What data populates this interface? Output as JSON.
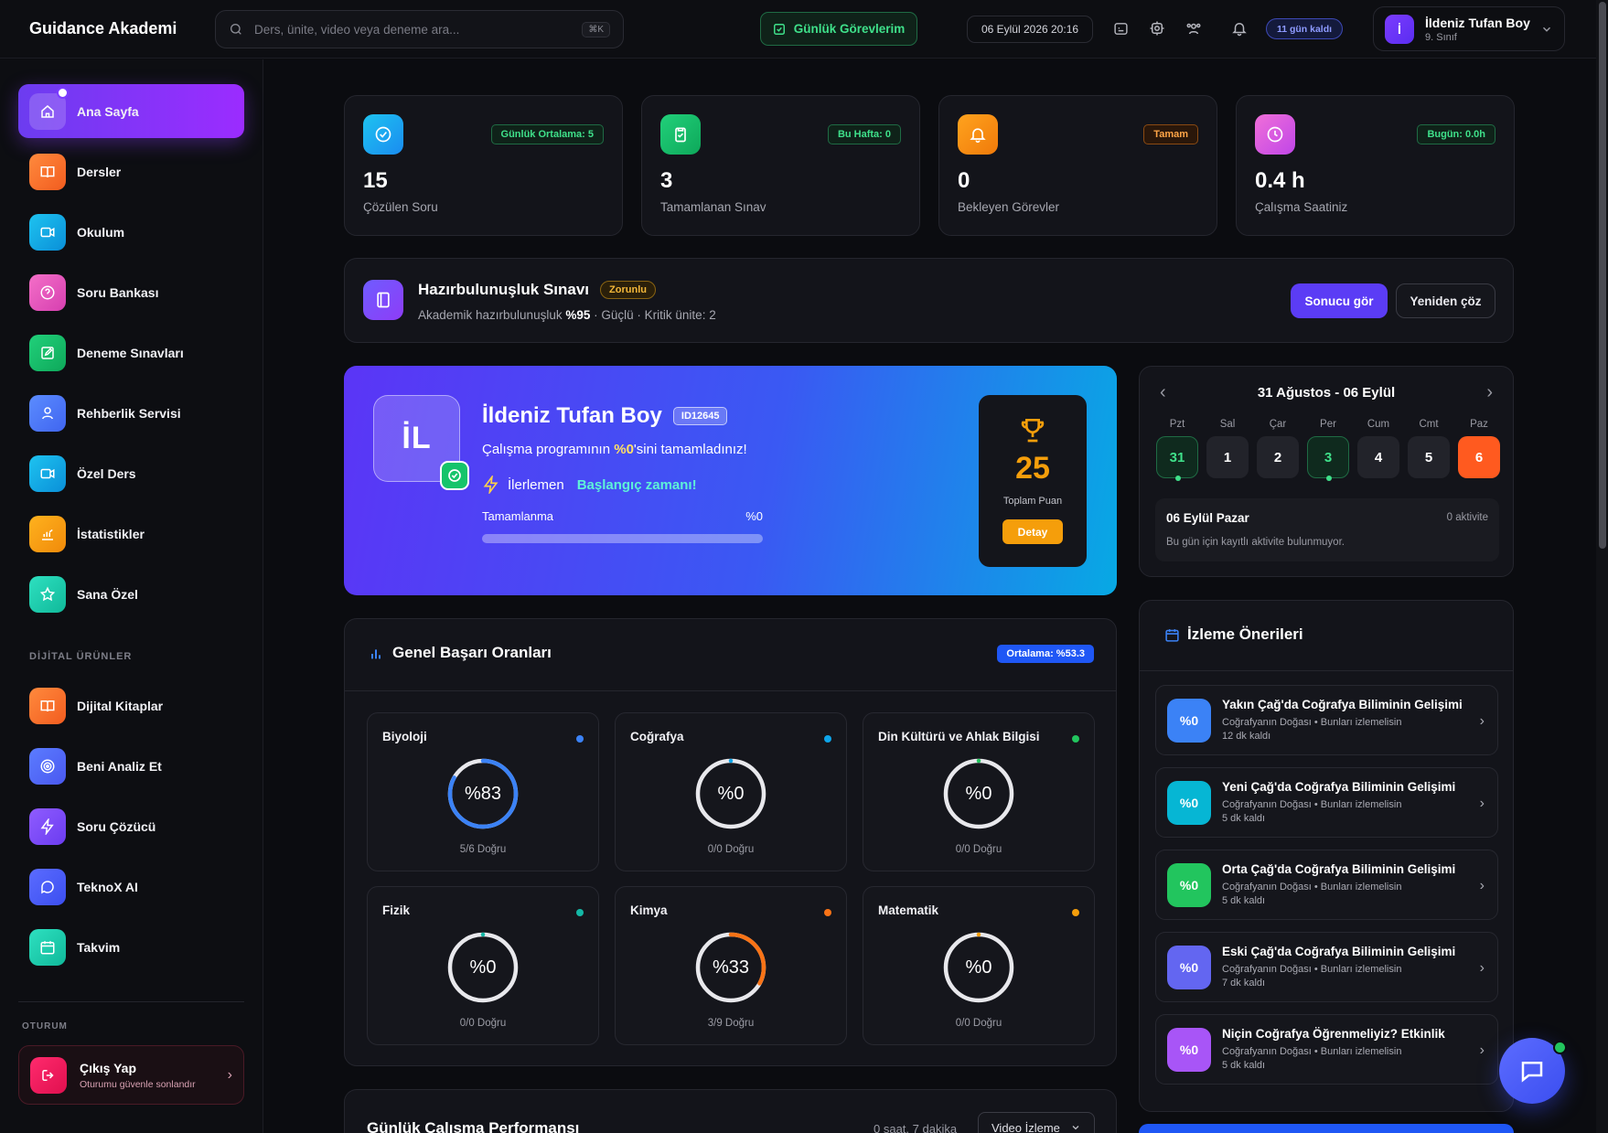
{
  "app": {
    "brand": "Guidance Akademi"
  },
  "search": {
    "placeholder": "Ders, ünite, video veya deneme ara...",
    "shortcut": "⌘K"
  },
  "header": {
    "tasks_label": "Günlük Görevlerim",
    "datetime": "06 Eylül 2026 20:16",
    "days_left": "11 gün kaldı",
    "user_initial": "İ",
    "user_name": "İldeniz Tufan Boy",
    "user_grade": "9. Sınıf"
  },
  "sidebar": {
    "items": [
      {
        "label": "Ana Sayfa",
        "icon": "home-icon"
      },
      {
        "label": "Dersler",
        "icon": "book-icon"
      },
      {
        "label": "Okulum",
        "icon": "video-icon"
      },
      {
        "label": "Soru Bankası",
        "icon": "question-icon"
      },
      {
        "label": "Deneme Sınavları",
        "icon": "edit-icon"
      },
      {
        "label": "Rehberlik Servisi",
        "icon": "user-icon"
      },
      {
        "label": "Özel Ders",
        "icon": "video-icon"
      },
      {
        "label": "İstatistikler",
        "icon": "chart-icon"
      },
      {
        "label": "Sana Özel",
        "icon": "star-icon"
      }
    ],
    "digital_label": "DİJİTAL ÜRÜNLER",
    "digital_items": [
      {
        "label": "Dijital Kitaplar",
        "icon": "book-icon"
      },
      {
        "label": "Beni Analiz Et",
        "icon": "target-icon"
      },
      {
        "label": "Soru Çözücü",
        "icon": "bolt-icon"
      },
      {
        "label": "TeknoX AI",
        "icon": "chat-icon"
      },
      {
        "label": "Takvim",
        "icon": "calendar-icon"
      }
    ],
    "session_label": "OTURUM",
    "logout_title": "Çıkış Yap",
    "logout_sub": "Oturumu güvenle sonlandır"
  },
  "stats": [
    {
      "value": "15",
      "label": "Çözülen Soru",
      "badge": "Günlük Ortalama: 5",
      "icon": "check-circle-icon"
    },
    {
      "value": "3",
      "label": "Tamamlanan Sınav",
      "badge": "Bu Hafta: 0",
      "icon": "clipboard-check-icon"
    },
    {
      "value": "0",
      "label": "Bekleyen Görevler",
      "badge": "Tamam",
      "icon": "bell-icon"
    },
    {
      "value": "0.4 h",
      "label": "Çalışma Saatiniz",
      "badge": "Bugün: 0.0h",
      "icon": "clock-icon"
    }
  ],
  "readiness": {
    "title": "Hazırbulunuşluk Sınavı",
    "tag": "Zorunlu",
    "desc_prefix": "Akademik hazırbulunuşluk",
    "desc_value": "%95",
    "desc_suffix": "· Güçlü · Kritik ünite: 2",
    "btn_result": "Sonucu gör",
    "btn_retry": "Yeniden çöz"
  },
  "hero": {
    "initials": "İL",
    "name": "İldeniz Tufan Boy",
    "id_badge": "ID12645",
    "progress_prefix": "Çalışma programının",
    "progress_value": "%0",
    "progress_suffix": "'sini tamamladınız!",
    "level_label": "İlerlemen",
    "level_value": "Başlangıç zamanı!",
    "completion_label": "Tamamlanma",
    "completion_value": "%0",
    "completion_fraction": 0,
    "points": "25",
    "points_label": "Toplam Puan",
    "detail_btn": "Detay"
  },
  "calendar": {
    "range": "31 Ağustos - 06 Eylül",
    "days": [
      {
        "name": "Pzt",
        "num": "31",
        "state": "marked"
      },
      {
        "name": "Sal",
        "num": "1",
        "state": "normal"
      },
      {
        "name": "Çar",
        "num": "2",
        "state": "normal"
      },
      {
        "name": "Per",
        "num": "3",
        "state": "marked"
      },
      {
        "name": "Cum",
        "num": "4",
        "state": "normal"
      },
      {
        "name": "Cmt",
        "num": "5",
        "state": "normal"
      },
      {
        "name": "Paz",
        "num": "6",
        "state": "today"
      }
    ],
    "selected_title": "06 Eylül Pazar",
    "selected_count": "0 aktivite",
    "selected_msg": "Bu gün için kayıtlı aktivite bulunmuyor."
  },
  "success": {
    "title": "Genel Başarı Oranları",
    "avg_badge": "Ortalama: %53.3",
    "subjects": [
      {
        "name": "Biyoloji",
        "value": "%83",
        "pct": 83,
        "foot": "5/6 Doğru",
        "color": "#3b82f6"
      },
      {
        "name": "Coğrafya",
        "value": "%0",
        "pct": 0,
        "foot": "0/0 Doğru",
        "color": "#0ea5e9"
      },
      {
        "name": "Din Kültürü ve Ahlak Bilgisi",
        "value": "%0",
        "pct": 0,
        "foot": "0/0 Doğru",
        "color": "#22c55e"
      },
      {
        "name": "Fizik",
        "value": "%0",
        "pct": 0,
        "foot": "0/0 Doğru",
        "color": "#14b8a6"
      },
      {
        "name": "Kimya",
        "value": "%33",
        "pct": 33,
        "foot": "3/9 Doğru",
        "color": "#f97316"
      },
      {
        "name": "Matematik",
        "value": "%0",
        "pct": 0,
        "foot": "0/0 Doğru",
        "color": "#f59e0b"
      }
    ]
  },
  "watch": {
    "title": "İzleme Önerileri",
    "items": [
      {
        "pct": "%0",
        "title": "Yakın Çağ'da Coğrafya Biliminin Gelişimi",
        "sub": "Coğrafyanın Doğası • Bunları izlemelisin",
        "time": "12 dk kaldı",
        "color": "#3b82f6"
      },
      {
        "pct": "%0",
        "title": "Yeni Çağ'da Coğrafya Biliminin Gelişimi",
        "sub": "Coğrafyanın Doğası • Bunları izlemelisin",
        "time": "5 dk kaldı",
        "color": "#06b6d4"
      },
      {
        "pct": "%0",
        "title": "Orta Çağ'da Coğrafya Biliminin Gelişimi",
        "sub": "Coğrafyanın Doğası • Bunları izlemelisin",
        "time": "5 dk kaldı",
        "color": "#22c55e"
      },
      {
        "pct": "%0",
        "title": "Eski Çağ'da Coğrafya Biliminin Gelişimi",
        "sub": "Coğrafyanın Doğası • Bunları izlemelisin",
        "time": "7 dk kaldı",
        "color": "#6366f1"
      },
      {
        "pct": "%0",
        "title": "Niçin Coğrafya Öğrenmeliyiz? Etkinlik",
        "sub": "Coğrafyanın Doğası • Bunları izlemelisin",
        "time": "5 dk kaldı",
        "color": "#a855f7"
      }
    ]
  },
  "daily": {
    "title": "Günlük Çalışma Performansı",
    "total": "0 saat, 7 dakika",
    "filter": "Video İzleme"
  }
}
